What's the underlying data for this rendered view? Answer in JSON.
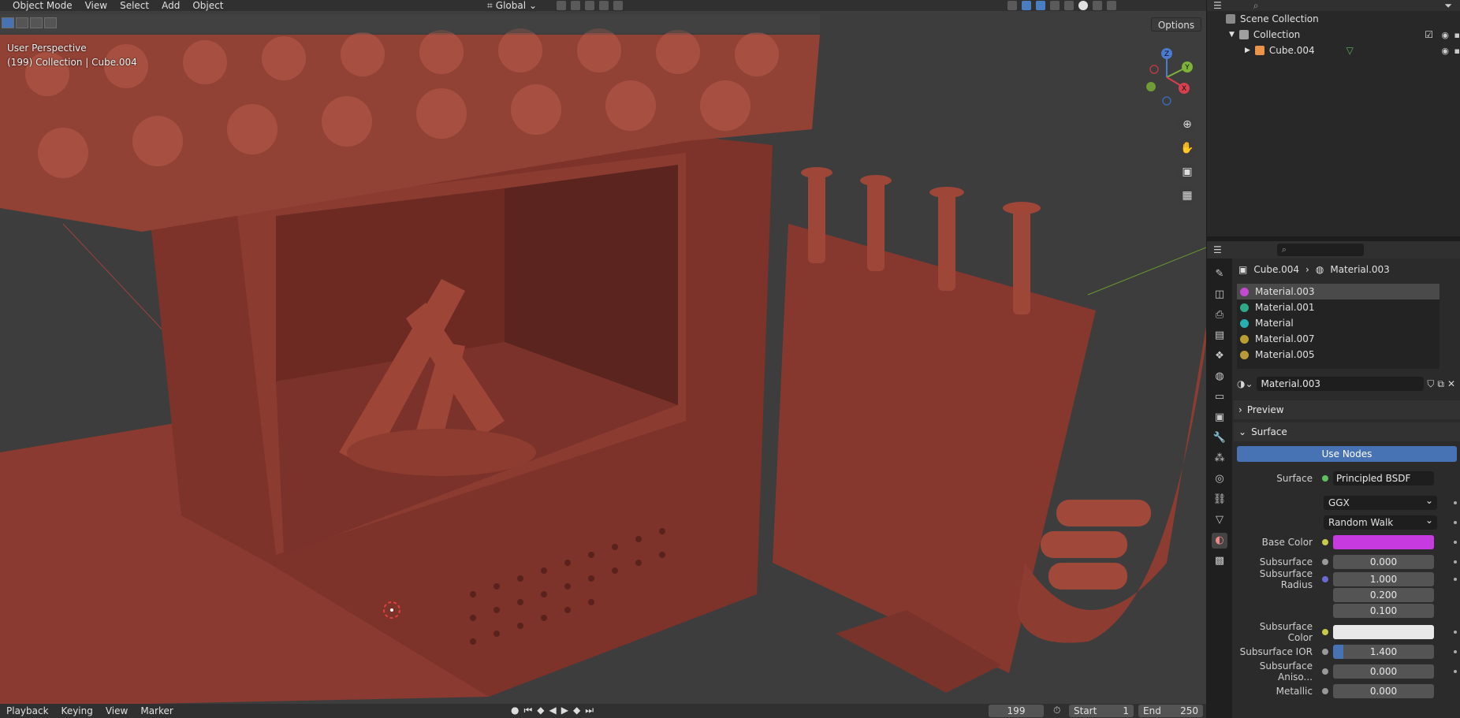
{
  "header": {
    "mode": "Object Mode",
    "menus": [
      "View",
      "Select",
      "Add",
      "Object"
    ],
    "transform_orientation": "Global"
  },
  "viewport": {
    "options_label": "Options",
    "info_line1": "User Perspective",
    "info_line2": "(199) Collection | Cube.004",
    "gizmo": {
      "z": "Z",
      "y": "Y",
      "x": "X"
    }
  },
  "timeline": {
    "menus": [
      "Playback",
      "Keying",
      "View",
      "Marker"
    ],
    "current_frame": "199",
    "start_label": "Start",
    "start_value": "1",
    "end_label": "End",
    "end_value": "250"
  },
  "outliner": {
    "rows": [
      {
        "label": "Scene Collection"
      },
      {
        "label": "Collection"
      },
      {
        "label": "Cube.004"
      }
    ]
  },
  "properties": {
    "breadcrumb_object": "Cube.004",
    "breadcrumb_material": "Material.003",
    "slots": [
      {
        "name": "Material.003",
        "color": "#c04ad0"
      },
      {
        "name": "Material.001",
        "color": "#2fa88a"
      },
      {
        "name": "Material",
        "color": "#26b0b0"
      },
      {
        "name": "Material.007",
        "color": "#b8a030"
      },
      {
        "name": "Material.005",
        "color": "#b89a3a"
      }
    ],
    "material_name": "Material.003",
    "preview_label": "Preview",
    "surface_panel_label": "Surface",
    "use_nodes_label": "Use Nodes",
    "surface_label": "Surface",
    "surface_shader": "Principled BSDF",
    "distribution": "GGX",
    "subsurface_method": "Random Walk",
    "rows": [
      {
        "label": "Base Color",
        "value": "",
        "color": "#c73ae0"
      },
      {
        "label": "Subsurface",
        "value": "0.000"
      },
      {
        "label": "Subsurface Radius",
        "values": [
          "1.000",
          "0.200",
          "0.100"
        ]
      },
      {
        "label": "Subsurface Color",
        "value": "",
        "color": "#e8e8e8"
      },
      {
        "label": "Subsurface IOR",
        "value": "1.400"
      },
      {
        "label": "Subsurface Aniso...",
        "value": "0.000"
      },
      {
        "label": "Metallic",
        "value": "0.000"
      }
    ]
  },
  "colors": {
    "accent": "#4772b3",
    "model": "#8a3b30"
  }
}
